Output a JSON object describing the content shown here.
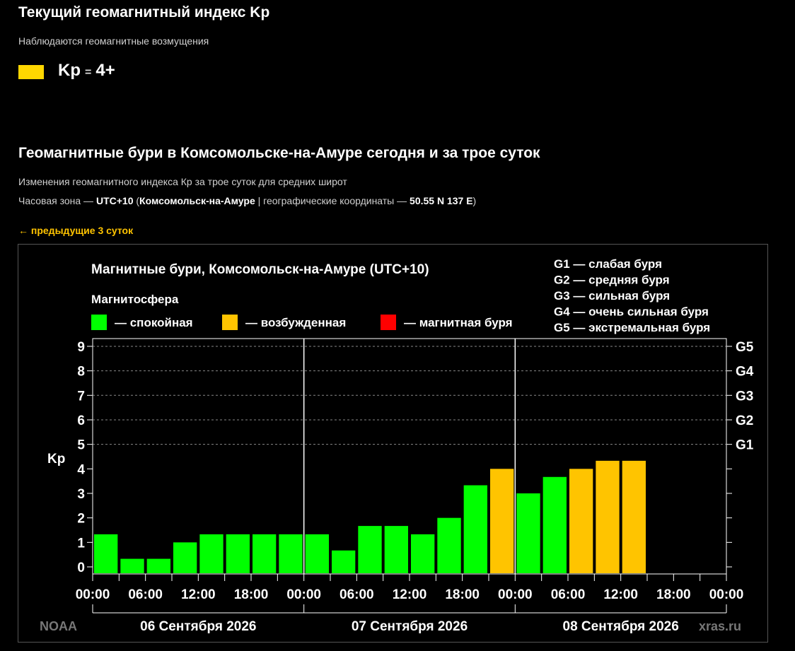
{
  "header": {
    "title": "Текущий геомагнитный индекс Kp",
    "status": "Наблюдаются геомагнитные возмущения",
    "kp_label": "Kp",
    "kp_eq": "=",
    "kp_value": "4+",
    "kp_color": "#ffd700"
  },
  "section": {
    "title": "Геомагнитные бури в Комсомольске-на-Амуре сегодня и за трое суток",
    "subtitle": "Изменения геомагнитного индекса Кр за трое суток для средних широт",
    "tz_prefix": "Часовая зона — ",
    "tz_value": "UTC+10",
    "tz_open": " (",
    "tz_city": "Комсомольск-на-Амуре",
    "tz_mid": " | географические координаты — ",
    "tz_coords": "50.55 N 137 E",
    "tz_close": ")",
    "prev_link": "← предыдущие 3 суток"
  },
  "chart_data": {
    "type": "bar",
    "title": "Магнитные бури, Комсомольск-на-Амуре (UTC+10)",
    "legend_title": "Магнитосфера",
    "legend": [
      {
        "label": "— спокойная",
        "color": "#00ff00"
      },
      {
        "label": "— возбужденная",
        "color": "#ffc400"
      },
      {
        "label": "— магнитная буря",
        "color": "#ff0000"
      }
    ],
    "storm_scale": [
      "G1 — слабая буря",
      "G2 — средняя буря",
      "G3 — сильная буря",
      "G4 — очень сильная буря",
      "G5 — экстремальная буря"
    ],
    "ylabel": "Kp",
    "ylim": [
      0,
      9
    ],
    "yticks": [
      "0",
      "1",
      "2",
      "3",
      "4",
      "5",
      "6",
      "7",
      "8",
      "9"
    ],
    "right_ticks": [
      {
        "label": "G1",
        "y": 5
      },
      {
        "label": "G2",
        "y": 6
      },
      {
        "label": "G3",
        "y": 7
      },
      {
        "label": "G4",
        "y": 8
      },
      {
        "label": "G5",
        "y": 9
      }
    ],
    "xticks": [
      "00:00",
      "06:00",
      "12:00",
      "18:00",
      "00:00",
      "06:00",
      "12:00",
      "18:00",
      "00:00",
      "06:00",
      "12:00",
      "18:00",
      "00:00"
    ],
    "days": [
      "06 Сентября 2026",
      "07 Сентября 2026",
      "08 Сентября 2026"
    ],
    "values": [
      1.33,
      0.33,
      0.33,
      1.0,
      1.33,
      1.33,
      1.33,
      1.33,
      1.33,
      0.67,
      1.67,
      1.67,
      1.33,
      2.0,
      3.33,
      4.0,
      3.0,
      3.67,
      4.0,
      4.33,
      4.33
    ],
    "bar_colors": [
      "#00ff00",
      "#00ff00",
      "#00ff00",
      "#00ff00",
      "#00ff00",
      "#00ff00",
      "#00ff00",
      "#00ff00",
      "#00ff00",
      "#00ff00",
      "#00ff00",
      "#00ff00",
      "#00ff00",
      "#00ff00",
      "#00ff00",
      "#ffc400",
      "#00ff00",
      "#00ff00",
      "#ffc400",
      "#ffc400",
      "#ffc400"
    ],
    "source_left": "NOAA",
    "source_right": "xras.ru",
    "grid": true
  }
}
